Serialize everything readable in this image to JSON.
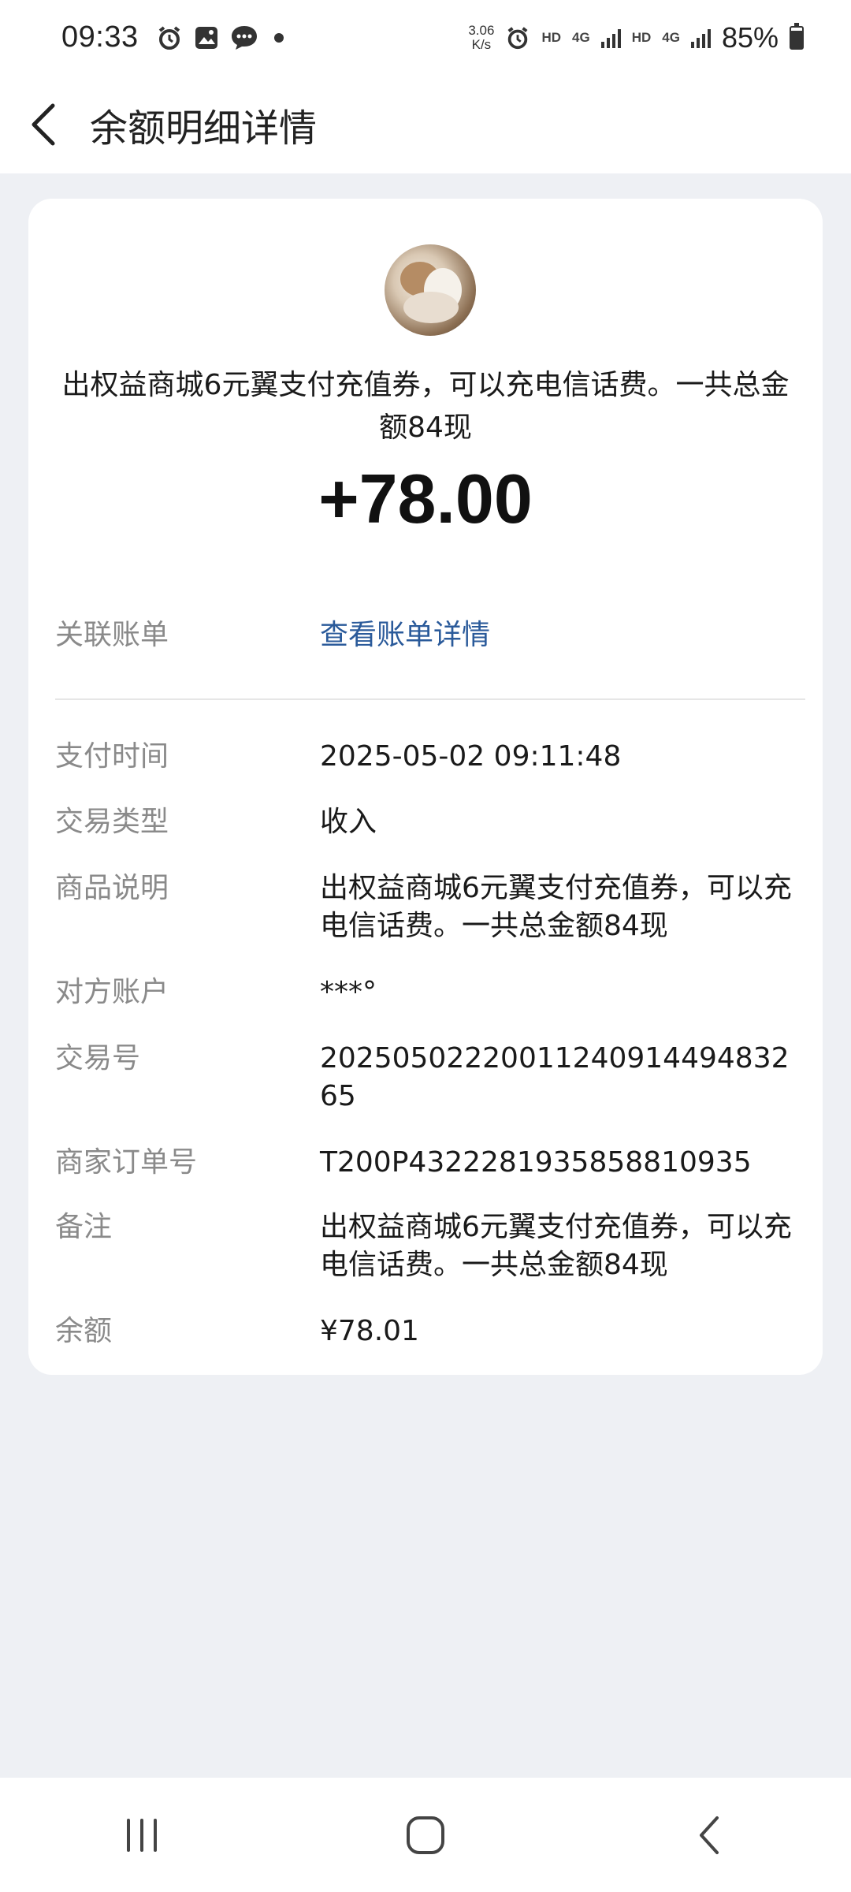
{
  "status_bar": {
    "time": "09:33",
    "net_speed_value": "3.06",
    "net_speed_unit": "K/s",
    "hd_label_1": "HD",
    "net_label_1": "4G",
    "hd_label_2": "HD",
    "net_label_2": "4G",
    "battery": "85%"
  },
  "header": {
    "title": "余额明细详情"
  },
  "summary": {
    "description": "出权益商城6元翼支付充值券，可以充电信话费。一共总金额84现",
    "amount": "+78.00"
  },
  "related_bill": {
    "label": "关联账单",
    "link_text": "查看账单详情"
  },
  "details": [
    {
      "label": "支付时间",
      "value": "2025-05-02 09:11:48"
    },
    {
      "label": "交易类型",
      "value": "收入"
    },
    {
      "label": "商品说明",
      "value": "出权益商城6元翼支付充值券，可以充电信话费。一共总金额84现"
    },
    {
      "label": "对方账户",
      "value": "***°"
    },
    {
      "label": "交易号",
      "value": "20250502220011240914494832 65"
    },
    {
      "label": "商家订单号",
      "value": "T200P4322281935858810935"
    },
    {
      "label": "备注",
      "value": "出权益商城6元翼支付充值券，可以充电信话费。一共总金额84现"
    },
    {
      "label": "余额",
      "value": "¥78.01"
    }
  ],
  "icons": {
    "back": "chevron-left-icon",
    "nav_recent": "recent-apps-icon",
    "nav_home": "home-icon",
    "nav_back": "nav-back-icon"
  },
  "colors": {
    "background": "#eef0f4",
    "card": "#ffffff",
    "link": "#2a5a9a",
    "label": "#8a8a8a"
  }
}
